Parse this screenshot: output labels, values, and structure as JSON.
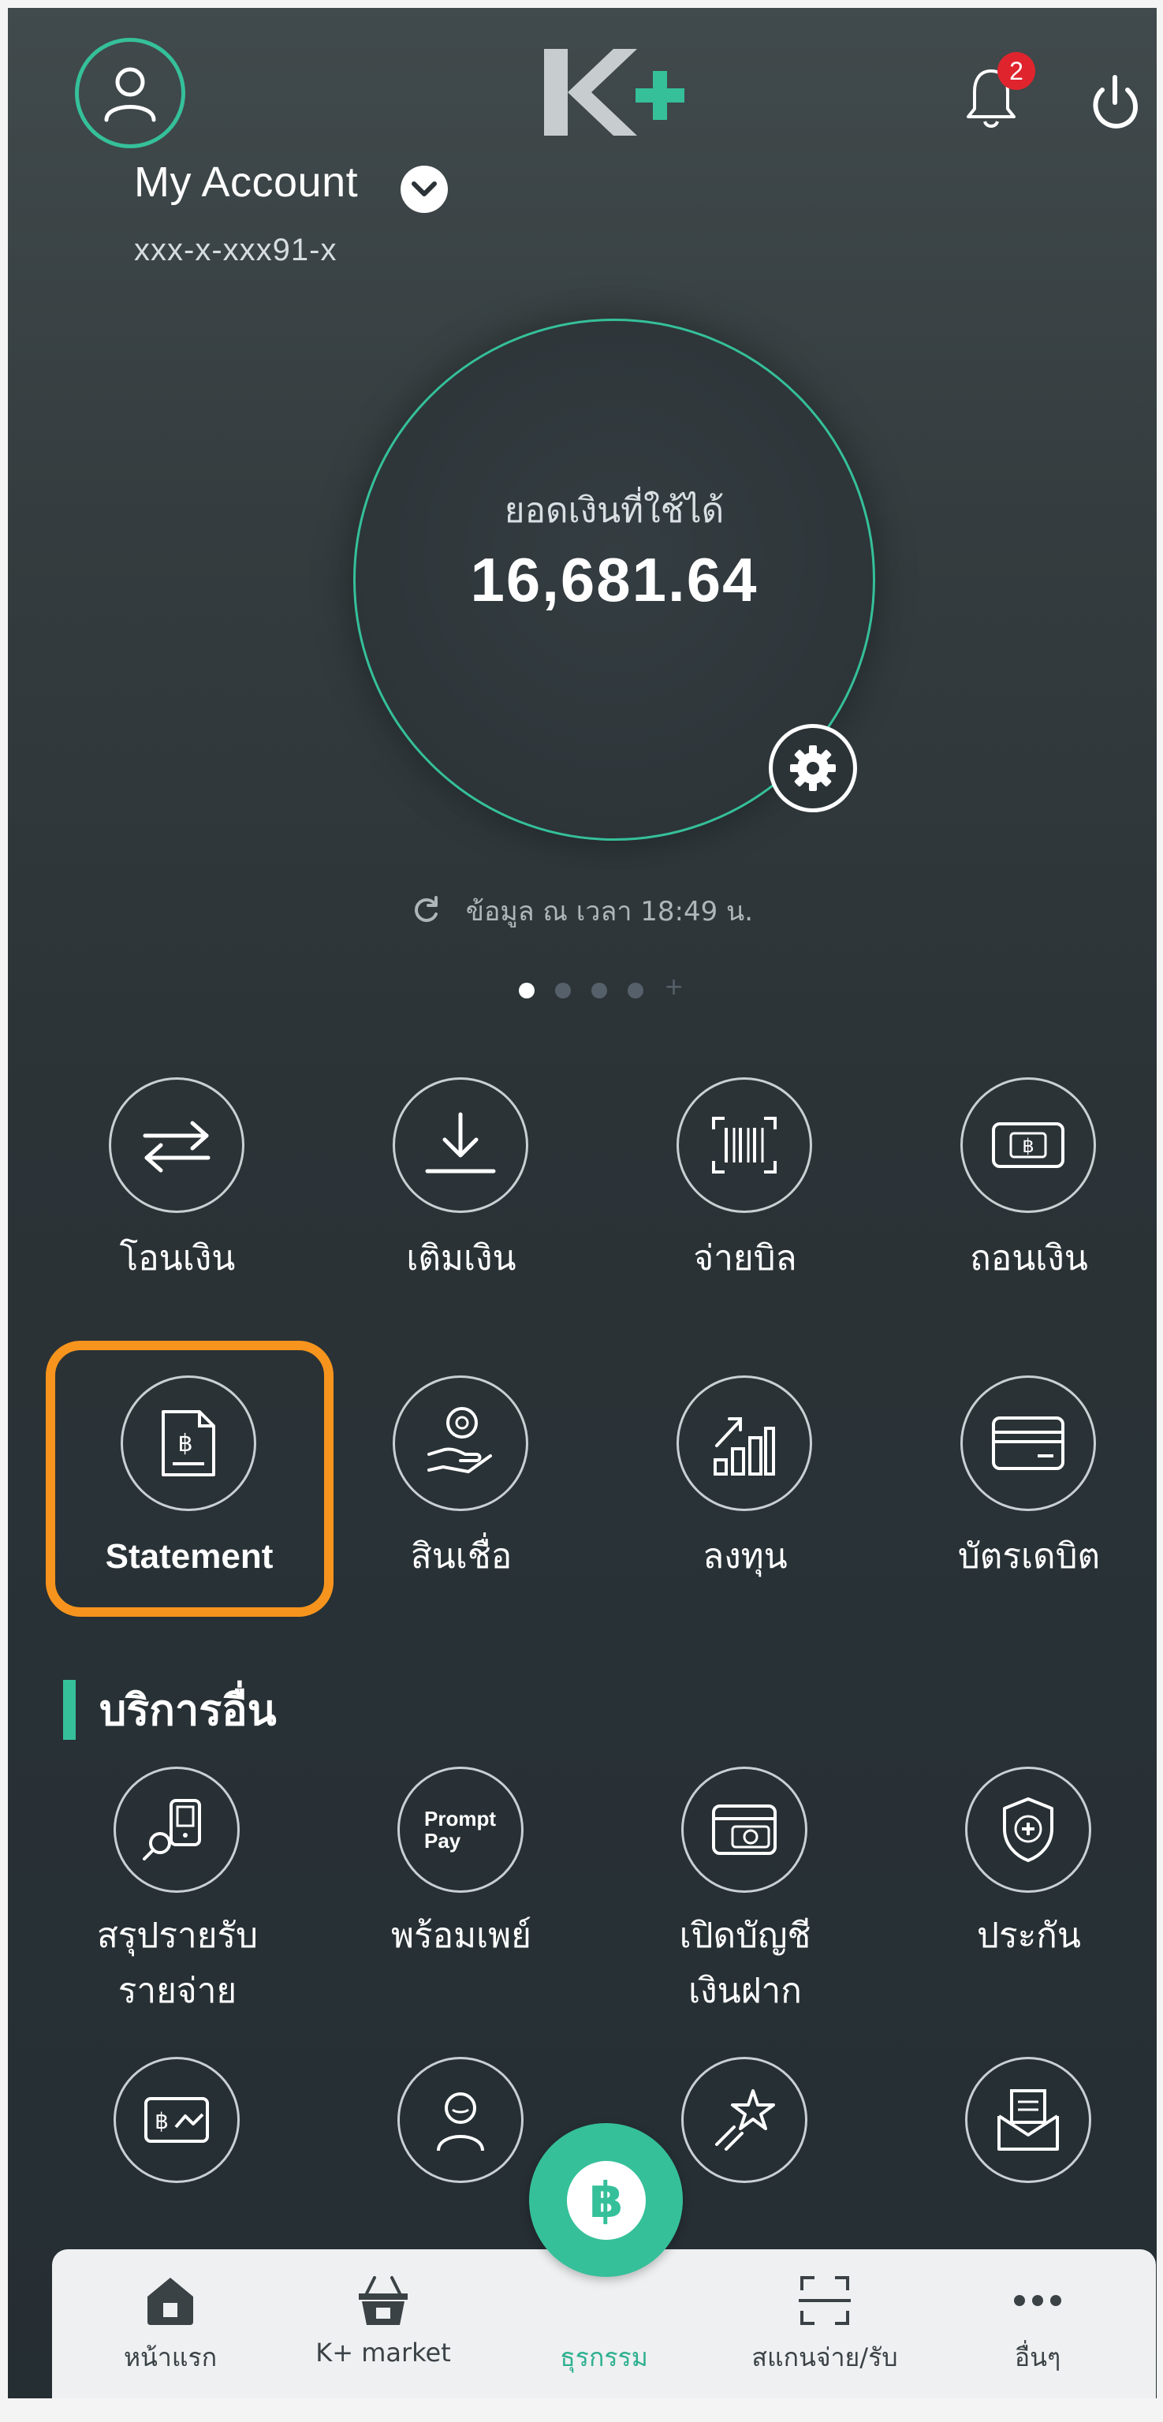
{
  "header": {
    "account_name": "My Account",
    "account_number": "xxx-x-xxx91-x",
    "notification_count": "2",
    "logo_text": "K+"
  },
  "balance": {
    "label": "ยอดเงินที่ใช้ได้",
    "value": "16,681.64",
    "updated_text": "ข้อมูล ณ เวลา 18:49 น.",
    "page_indicator": {
      "total_dots": 4,
      "active_index": 0,
      "has_add": true
    }
  },
  "menu": {
    "row1": [
      {
        "label": "โอนเงิน",
        "icon": "transfer-icon"
      },
      {
        "label": "เติมเงิน",
        "icon": "topup-icon"
      },
      {
        "label": "จ่ายบิล",
        "icon": "barcode-icon"
      },
      {
        "label": "ถอนเงิน",
        "icon": "withdraw-icon"
      }
    ],
    "row2": [
      {
        "label": "Statement",
        "icon": "statement-icon"
      },
      {
        "label": "สินเชื่อ",
        "icon": "loan-icon"
      },
      {
        "label": "ลงทุน",
        "icon": "invest-icon"
      },
      {
        "label": "บัตรเดบิต",
        "icon": "card-icon"
      }
    ]
  },
  "other_services": {
    "title": "บริการอื่น",
    "items": [
      {
        "label_line1": "สรุปรายรับ",
        "label_line2": "รายจ่าย",
        "icon": "summary-icon"
      },
      {
        "label_line1": "พร้อมเพย์",
        "label_line2": "",
        "icon": "promptpay-icon",
        "icon_text_1": "Prompt",
        "icon_text_2": "Pay"
      },
      {
        "label_line1": "เปิดบัญชี",
        "label_line2": "เงินฝาก",
        "icon": "open-account-icon"
      },
      {
        "label_line1": "ประกัน",
        "label_line2": "",
        "icon": "insurance-icon"
      }
    ],
    "row4_icons": [
      "bill-card-icon",
      "person-icon",
      "star-rocket-icon",
      "mail-icon"
    ]
  },
  "bottom_nav": [
    {
      "label": "หน้าแรก",
      "icon": "home-icon"
    },
    {
      "label": "K+ market",
      "icon": "basket-icon"
    },
    {
      "label": "ธุรกรรม",
      "icon": "baht-icon",
      "active": true
    },
    {
      "label": "สแกนจ่าย/รับ",
      "icon": "scan-icon"
    },
    {
      "label": "อื่นๆ",
      "icon": "more-icon"
    }
  ],
  "colors": {
    "accent": "#35c09a",
    "highlight": "#f7941d",
    "badge": "#e0242d",
    "background": "#2b3337"
  }
}
